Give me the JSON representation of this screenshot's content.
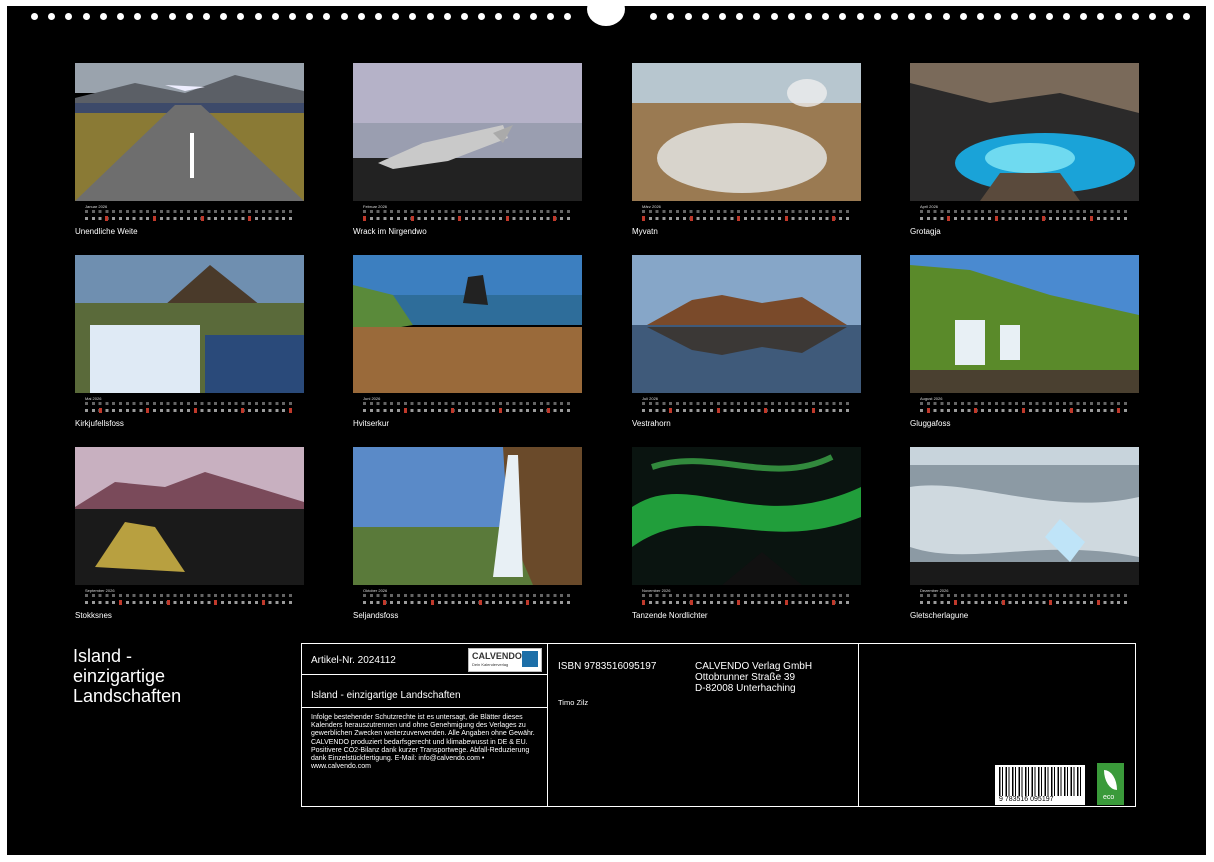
{
  "months": [
    {
      "name": "Januar 2026",
      "caption": "Unendliche Weite",
      "sundays": [
        3
      ]
    },
    {
      "name": "Februar 2026",
      "caption": "Wrack im Nirgendwo",
      "sundays": [
        0
      ]
    },
    {
      "name": "März 2026",
      "caption": "Myvatn",
      "sundays": [
        0
      ]
    },
    {
      "name": "April 2026",
      "caption": "Grotagja",
      "sundays": [
        4
      ]
    },
    {
      "name": "Mai 2026",
      "caption": "Kirkjufellsfoss",
      "sundays": [
        2
      ]
    },
    {
      "name": "Juni 2026",
      "caption": "Hvitserkur",
      "sundays": [
        6
      ]
    },
    {
      "name": "Juli 2026",
      "caption": "Vestrahorn",
      "sundays": [
        4
      ]
    },
    {
      "name": "August 2026",
      "caption": "Gluggafoss",
      "sundays": [
        1
      ]
    },
    {
      "name": "September 2026",
      "caption": "Stokksnes",
      "sundays": [
        5
      ]
    },
    {
      "name": "Oktober 2026",
      "caption": "Seljandsfoss",
      "sundays": [
        3
      ]
    },
    {
      "name": "November 2026",
      "caption": "Tanzende Nordlichter",
      "sundays": [
        0
      ]
    },
    {
      "name": "Dezember 2026",
      "caption": "Gletscherlagune",
      "sundays": [
        5
      ]
    }
  ],
  "title": {
    "line1": "Island -",
    "line2": "einzigartige",
    "line3": "Landschaften"
  },
  "imprint": {
    "article": "Artikel-Nr. 2024112",
    "subtitle": "Island - einzigartige Landschaften",
    "legal": "Infolge bestehender Schutzrechte ist es untersagt, die Blätter dieses Kalenders herauszutrennen und ohne Genehmigung des Verlages zu gewerblichen Zwecken weiterzuverwenden. Alle Angaben ohne Gewähr. CALVENDO produziert bedarfsgerecht und klimabewusst in DE & EU. Positivere CO2-Bilanz dank kurzer Transportwege. Abfall-Reduzierung dank Einzelstückfertigung. E-Mail: info@calvendo.com • www.calvendo.com",
    "isbn": "ISBN 9783516095197",
    "author": "Timo Zilz",
    "publisher1": "CALVENDO Verlag GmbH",
    "publisher2": "Ottobrunner Straße 39",
    "publisher3": "D-82008 Unterhaching",
    "logo": "CALVENDO",
    "logo_sub": "Dein Kalenderverlag",
    "barcode": "9 783516 095197",
    "eco": "eco"
  },
  "colors": {
    "sheet": "#000000",
    "sunday": "#c0392b",
    "text": "#ffffff"
  }
}
